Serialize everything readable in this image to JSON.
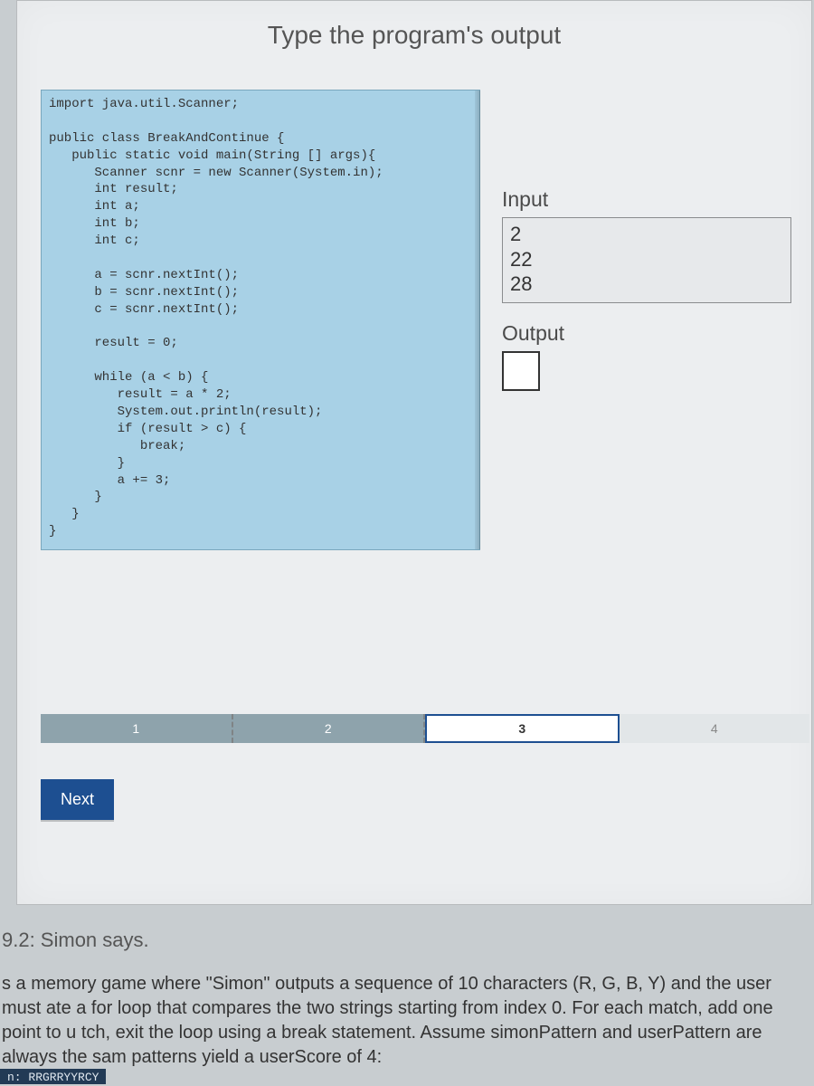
{
  "title": "Type the program's output",
  "code": "import java.util.Scanner;\n\npublic class BreakAndContinue {\n   public static void main(String [] args){\n      Scanner scnr = new Scanner(System.in);\n      int result;\n      int a;\n      int b;\n      int c;\n\n      a = scnr.nextInt();\n      b = scnr.nextInt();\n      c = scnr.nextInt();\n\n      result = 0;\n\n      while (a < b) {\n         result = a * 2;\n         System.out.println(result);\n         if (result > c) {\n            break;\n         }\n         a += 3;\n      }\n   }\n}",
  "io": {
    "input_label": "Input",
    "input_lines": "2\n22\n28",
    "output_label": "Output",
    "output_value": ""
  },
  "stepper": {
    "steps": [
      {
        "label": "1",
        "state": "done"
      },
      {
        "label": "2",
        "state": "done"
      },
      {
        "label": "3",
        "state": "current"
      },
      {
        "label": "4",
        "state": "future"
      }
    ]
  },
  "next_button": "Next",
  "lower": {
    "heading": "9.2: Simon says.",
    "body": "s a memory game where \"Simon\" outputs a sequence of 10 characters (R, G, B, Y) and the user must\nate a for loop that compares the two strings starting from index 0. For each match, add one point to u\ntch, exit the loop using a break statement. Assume simonPattern and userPattern are always the sam\npatterns yield a userScore of 4:"
  },
  "footer_snippet": "n:  RRGRRYYRCY"
}
